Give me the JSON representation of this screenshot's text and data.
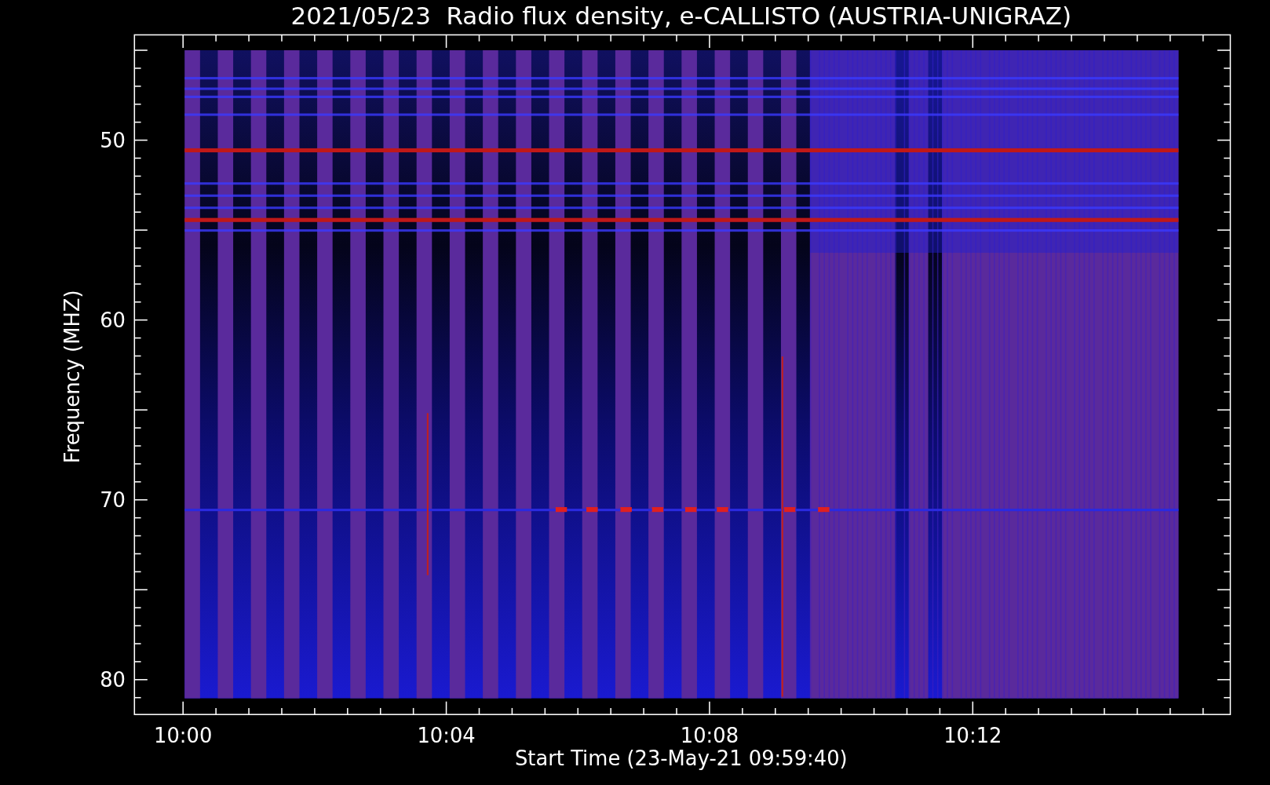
{
  "title": "2021/05/23  Radio flux density, e-CALLISTO (AUSTRIA-UNIGRAZ)",
  "y_axis": {
    "label": "Frequency (MHZ)",
    "ticks": [
      "50",
      "60",
      "70",
      "80"
    ]
  },
  "x_axis": {
    "label": "Start Time (23-May-21 09:59:40)",
    "ticks": [
      "10:00",
      "10:04",
      "10:08",
      "10:12"
    ]
  }
}
